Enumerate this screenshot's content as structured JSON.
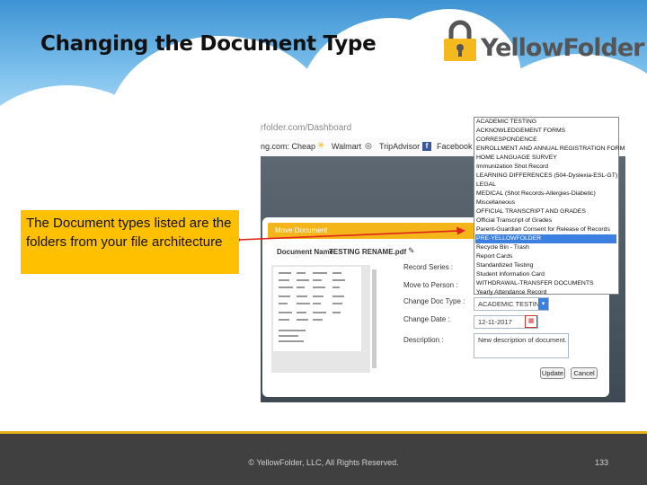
{
  "slide": {
    "title": "Changing the Document Type",
    "logo_text": "YellowFolder",
    "callout": "The Document types listed are the folders from your file architecture",
    "footer": "© YellowFolder, LLC, All Rights Reserved.",
    "page_number": "133"
  },
  "browser": {
    "url": "rfolder.com/Dashboard",
    "bookmarks": [
      "ng.com: Cheap",
      "Walmart",
      "TripAdvisor",
      "Facebook"
    ]
  },
  "modal": {
    "header": "Move Document",
    "doc_name_label": "Document Name",
    "doc_name": "TESTING RENAME.pdf",
    "labels": {
      "record_series": "Record Series :",
      "move_to_person": "Move to Person :",
      "change_doc_type": "Change Doc Type :",
      "change_date": "Change Date :",
      "description": "Description :"
    },
    "doc_type_value": "ACADEMIC TESTING",
    "date_value": "12-11-2017",
    "description_value": "New description of document.",
    "update_button": "Update",
    "cancel_button": "Cancel"
  },
  "doc_type_options": [
    "ACADEMIC TESTING",
    "ACKNOWLEDGEMENT FORMS",
    "CORRESPONDENCE",
    "ENROLLMENT AND ANNUAL REGISTRATION FORMS",
    "HOME LANGUAGE SURVEY",
    "Immunization Shot Record",
    "LEARNING DIFFERENCES (504-Dyslexia-ESL-GT)",
    "LEGAL",
    "MEDICAL (Shot Records-Allergies-Diabetic)",
    "Miscellaneous",
    "OFFICIAL TRANSCRIPT AND GRADES",
    "Official Transcript of Grades",
    "Parent-Guardian Consent for Release of Records",
    "PRE-YELLOWFOLDER",
    "Recycle Bin - Trash",
    "Report Cards",
    "Standardized Testing",
    "Student Information Card",
    "WITHDRAWAL-TRANSFER DOCUMENTS",
    "Yearly Attendance Record"
  ],
  "selected_option_index": 13,
  "colors": {
    "accent_yellow": "#ffc000",
    "selected_blue": "#3b80e0",
    "arrow_red": "#e0241b",
    "footer_bg": "#404040"
  }
}
